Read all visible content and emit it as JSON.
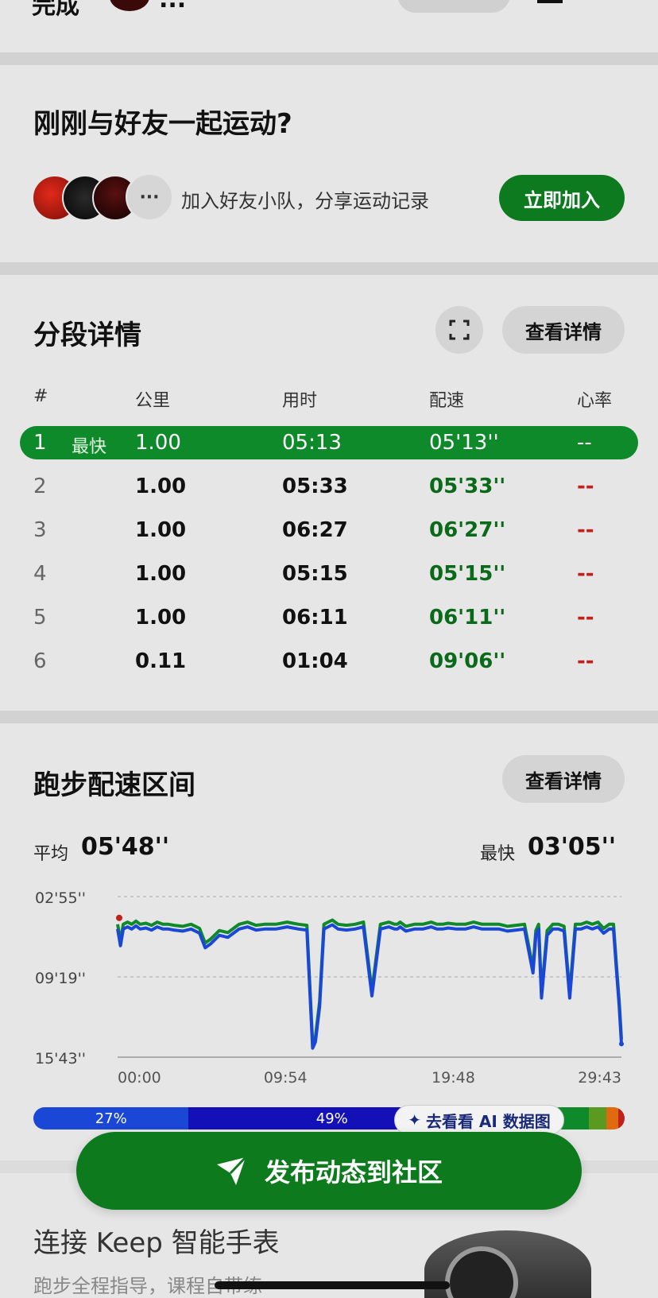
{
  "top_bar": {
    "left_text": "完成",
    "title_text": "...",
    "colors": {
      "pill": "#d0d0d0"
    }
  },
  "friends": {
    "title": "刚刚与好友一起运动?",
    "more_label": "···",
    "subtitle": "加入好友小队，分享运动记录",
    "join_button": "立即加入",
    "avatars": [
      "avatar-flag",
      "avatar-dark",
      "avatar-red"
    ]
  },
  "splits": {
    "title": "分段详情",
    "detail_button": "查看详情",
    "expand_icon": "fullscreen-icon",
    "headers": [
      "#",
      "公里",
      "用时",
      "配速",
      "心率"
    ],
    "best_tag": "最快",
    "rows": [
      {
        "idx": "1",
        "km": "1.00",
        "time": "05:13",
        "pace": "05'13''",
        "hr": "--",
        "best": true
      },
      {
        "idx": "2",
        "km": "1.00",
        "time": "05:33",
        "pace": "05'33''",
        "hr": "--",
        "best": false
      },
      {
        "idx": "3",
        "km": "1.00",
        "time": "06:27",
        "pace": "06'27''",
        "hr": "--",
        "best": false
      },
      {
        "idx": "4",
        "km": "1.00",
        "time": "05:15",
        "pace": "05'15''",
        "hr": "--",
        "best": false
      },
      {
        "idx": "5",
        "km": "1.00",
        "time": "06:11",
        "pace": "06'11''",
        "hr": "--",
        "best": false
      },
      {
        "idx": "6",
        "km": "0.11",
        "time": "01:04",
        "pace": "09'06''",
        "hr": "--",
        "best": false
      }
    ]
  },
  "pace_zone": {
    "title": "跑步配速区间",
    "detail_button": "查看详情",
    "avg_label": "平均",
    "avg_value": "05'48''",
    "fast_label": "最快",
    "fast_value": "03'05''",
    "ai_button": "去看看 AI 数据图",
    "zones": [
      {
        "label": "27%",
        "value": 26,
        "color": "#1a47d6"
      },
      {
        "label": "49%",
        "value": 48,
        "color": "#1410b8"
      },
      {
        "label": "",
        "value": 19,
        "color": "#0e8a2a"
      },
      {
        "label": "",
        "value": 3,
        "color": "#5a9a20"
      },
      {
        "label": "",
        "value": 2,
        "color": "#e06a10"
      },
      {
        "label": "",
        "value": 1,
        "color": "#c0211a"
      }
    ]
  },
  "chart_data": {
    "type": "line",
    "title": "",
    "xlabel": "",
    "ylabel": "",
    "y_tick_labels": [
      "02'55''",
      "09'19''",
      "15'43''"
    ],
    "x_tick_labels": [
      "00:00",
      "09:54",
      "19:48",
      "29:43"
    ],
    "y_ticks_seconds": [
      175,
      559,
      943
    ],
    "ylim_seconds_inverted": [
      175,
      943
    ],
    "xlim_seconds": [
      0,
      1783
    ],
    "grid": "dashed horizontal",
    "series": [
      {
        "x": [
          0,
          10,
          20,
          35,
          50,
          65,
          80,
          100,
          120,
          140,
          160,
          180,
          200,
          230,
          260,
          290,
          310,
          330,
          360,
          390,
          410,
          430,
          460,
          490,
          520,
          560,
          600,
          640,
          670,
          690,
          700,
          715,
          730,
          745,
          760,
          780,
          810,
          840,
          870,
          900,
          930,
          960,
          980,
          990,
          1000,
          1020,
          1050,
          1080,
          1110,
          1130,
          1150,
          1170,
          1200,
          1230,
          1260,
          1290,
          1320,
          1350,
          1380,
          1410,
          1440,
          1470,
          1480,
          1490,
          1500,
          1520,
          1540,
          1560,
          1580,
          1600,
          1620,
          1640,
          1660,
          1680,
          1700,
          1720,
          1740,
          1755,
          1765,
          1775,
          1783
        ],
        "y": [
          330,
          410,
          330,
          320,
          330,
          315,
          330,
          325,
          335,
          320,
          330,
          330,
          335,
          340,
          330,
          350,
          420,
          400,
          360,
          370,
          350,
          330,
          320,
          335,
          330,
          330,
          320,
          330,
          335,
          900,
          870,
          700,
          330,
          320,
          310,
          330,
          335,
          330,
          320,
          650,
          330,
          320,
          330,
          330,
          320,
          340,
          330,
          330,
          320,
          330,
          330,
          325,
          330,
          330,
          320,
          330,
          330,
          330,
          340,
          335,
          330,
          540,
          360,
          330,
          660,
          360,
          330,
          330,
          340,
          660,
          330,
          330,
          320,
          330,
          320,
          350,
          330,
          330,
          520,
          700,
          880
        ]
      }
    ],
    "line_gradient_colors": [
      "#1a47d6",
      "#0e8a2a",
      "#c0211a"
    ]
  },
  "publish": {
    "label": "发布动态到社区",
    "icon": "send-icon"
  },
  "keep": {
    "title": "连接 Keep 智能手表",
    "subtitle": "跑步全程指导，课程自带练"
  }
}
